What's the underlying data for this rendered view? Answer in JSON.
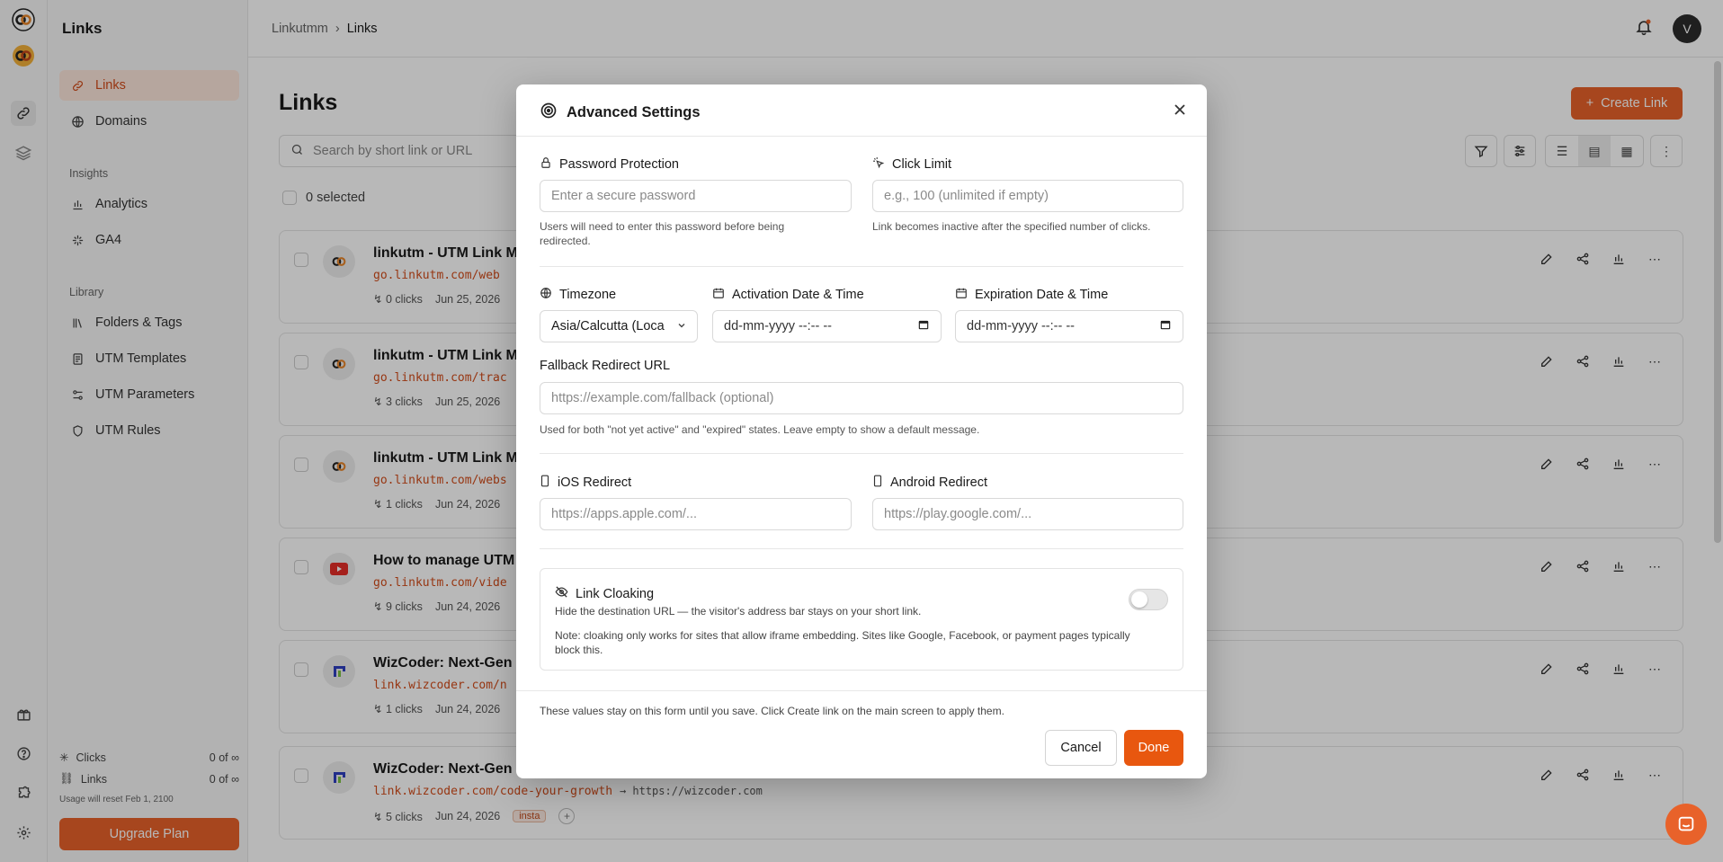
{
  "app": {
    "sidebar_title": "Links",
    "breadcrumb": [
      "Linkutmm",
      "Links"
    ],
    "avatar_initial": "V",
    "accent": "#e8622a"
  },
  "sidebar": {
    "main_items": [
      {
        "label": "Links",
        "icon": "link-icon",
        "active": true
      },
      {
        "label": "Domains",
        "icon": "globe-icon",
        "active": false
      }
    ],
    "insights_label": "Insights",
    "insights_items": [
      {
        "label": "Analytics",
        "icon": "bar-chart-icon"
      },
      {
        "label": "GA4",
        "icon": "sparkle-icon"
      }
    ],
    "library_label": "Library",
    "library_items": [
      {
        "label": "Folders & Tags",
        "icon": "library-icon"
      },
      {
        "label": "UTM Templates",
        "icon": "template-icon"
      },
      {
        "label": "UTM Parameters",
        "icon": "sliders-icon"
      },
      {
        "label": "UTM Rules",
        "icon": "shield-icon"
      }
    ],
    "usage": [
      {
        "label": "Clicks",
        "value": "0 of ∞"
      },
      {
        "label": "Links",
        "value": "0 of ∞"
      }
    ],
    "usage_reset": "Usage will reset Feb 1, 2100",
    "upgrade_label": "Upgrade Plan"
  },
  "main": {
    "title": "Links",
    "create_label": "Create Link",
    "search_placeholder": "Search by short link or URL",
    "selected_label": "0 selected",
    "cards": [
      {
        "title": "linkutm - UTM Link M",
        "url": "go.linkutm.com/web",
        "dest": "",
        "clicks": "0 clicks",
        "date": "Jun 25, 2026",
        "fav": "linkutm",
        "tag": ""
      },
      {
        "title": "linkutm - UTM Link M",
        "url": "go.linkutm.com/trac",
        "dest": "",
        "clicks": "3 clicks",
        "date": "Jun 25, 2026",
        "fav": "linkutm",
        "tag": ""
      },
      {
        "title": "linkutm - UTM Link M",
        "url": "go.linkutm.com/webs",
        "dest": "",
        "clicks": "1 clicks",
        "date": "Jun 24, 2026",
        "fav": "linkutm",
        "tag": ""
      },
      {
        "title": "How to manage UTM",
        "url": "go.linkutm.com/vide",
        "dest": "",
        "clicks": "9 clicks",
        "date": "Jun 24, 2026",
        "fav": "youtube",
        "tag": ""
      },
      {
        "title": "WizCoder: Next-Gen",
        "url": "link.wizcoder.com/n",
        "dest": "",
        "clicks": "1 clicks",
        "date": "Jun 24, 2026",
        "fav": "wizcoder",
        "tag": ""
      },
      {
        "title": "WizCoder: Next-Gen",
        "url": "link.wizcoder.com/code-your-growth",
        "dest": "→ https://wizcoder.com",
        "clicks": "5 clicks",
        "date": "Jun 24, 2026",
        "fav": "wizcoder",
        "tag": "insta"
      }
    ]
  },
  "modal": {
    "title": "Advanced Settings",
    "password": {
      "label": "Password Protection",
      "placeholder": "Enter a secure password",
      "value": "",
      "hint": "Users will need to enter this password before being redirected."
    },
    "click_limit": {
      "label": "Click Limit",
      "placeholder": "e.g., 100 (unlimited if empty)",
      "value": "",
      "hint": "Link becomes inactive after the specified number of clicks."
    },
    "timezone": {
      "label": "Timezone",
      "value": "Asia/Calcutta (Loca"
    },
    "activation": {
      "label": "Activation Date & Time",
      "value": "dd-mm-yyyy --:-- --"
    },
    "expiration": {
      "label": "Expiration Date & Time",
      "value": "dd-mm-yyyy --:-- --"
    },
    "fallback": {
      "label": "Fallback Redirect URL",
      "placeholder": "https://example.com/fallback (optional)",
      "value": "",
      "hint": "Used for both \"not yet active\" and \"expired\" states. Leave empty to show a default message."
    },
    "ios": {
      "label": "iOS Redirect",
      "placeholder": "https://apps.apple.com/...",
      "value": ""
    },
    "android": {
      "label": "Android Redirect",
      "placeholder": "https://play.google.com/...",
      "value": ""
    },
    "cloaking": {
      "label": "Link Cloaking",
      "description": "Hide the destination URL — the visitor's address bar stays on your short link.",
      "note": "Note: cloaking only works for sites that allow iframe embedding. Sites like Google, Facebook, or payment pages typically block this.",
      "enabled": false
    },
    "footer_note": "These values stay on this form until you save. Click Create link on the main screen to apply them.",
    "cancel_label": "Cancel",
    "done_label": "Done"
  }
}
